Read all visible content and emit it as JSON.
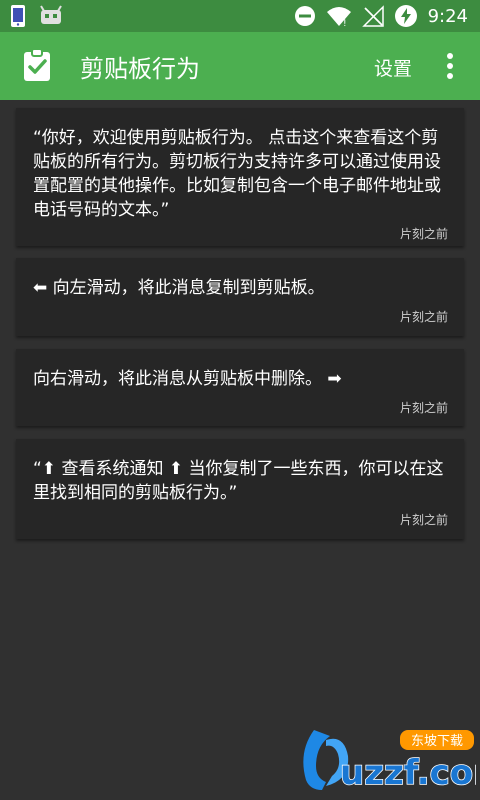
{
  "status_bar": {
    "time": "9:24",
    "left_icons": [
      "phone-icon",
      "android-icon"
    ],
    "right_icons": [
      "do-not-disturb-icon",
      "wifi-icon",
      "no-sim-icon",
      "battery-charging-icon"
    ]
  },
  "toolbar": {
    "title": "剪贴板行为",
    "settings_label": "设置",
    "app_icon": "clipboard-check-icon",
    "more_icon": "more-vert-icon"
  },
  "cards": [
    {
      "text": "“你好，欢迎使用剪贴板行为。 点击这个来查看这个剪贴板的所有行为。剪切板行为支持许多可以通过使用设置配置的其他操作。比如复制包含一个电子邮件地址或电话号码的文本。”",
      "time": "片刻之前"
    },
    {
      "text": "⬅ 向左滑动，将此消息复制到剪贴板。",
      "time": "片刻之前"
    },
    {
      "text": "向右滑动，将此消息从剪贴板中删除。 ➡",
      "time": "片刻之前"
    },
    {
      "text": "“⬆ 查看系统通知 ⬆ 当你复制了一些东西，你可以在这里找到相同的剪贴板行为。”",
      "time": "片刻之前"
    }
  ],
  "watermark": {
    "brand": "uzzf.com",
    "tag": "东坡下载"
  },
  "colors": {
    "status_bar": "#3d8c40",
    "toolbar": "#4caf50",
    "background": "#303030",
    "card": "#262626"
  }
}
